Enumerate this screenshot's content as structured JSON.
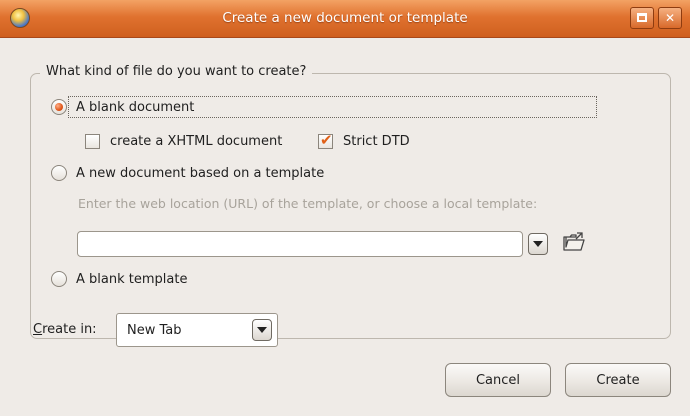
{
  "window": {
    "title": "Create a new document or template",
    "maximize_icon": "maximize-icon",
    "close_symbol": "✕"
  },
  "group": {
    "legend": "What kind of file do you want to create?",
    "option_blank_document": {
      "label": "A blank document",
      "selected": true
    },
    "checkbox_xhtml": {
      "label": "create a XHTML document",
      "checked": false
    },
    "checkbox_strict": {
      "label": "Strict DTD",
      "checked": true
    },
    "option_template": {
      "label": "A new document based on a template",
      "selected": false
    },
    "template_hint": "Enter the web location (URL) of the template, or choose a local template:",
    "template_url": {
      "value": ""
    },
    "option_blank_template": {
      "label": "A blank template",
      "selected": false
    }
  },
  "create_in": {
    "label_prefix": "C",
    "label_rest": "reate in:",
    "value": "New Tab"
  },
  "buttons": {
    "cancel": "Cancel",
    "create": "Create"
  },
  "colors": {
    "titlebar": "#e0722f",
    "accent": "#e0561a",
    "dialog_bg": "#efebe7"
  }
}
